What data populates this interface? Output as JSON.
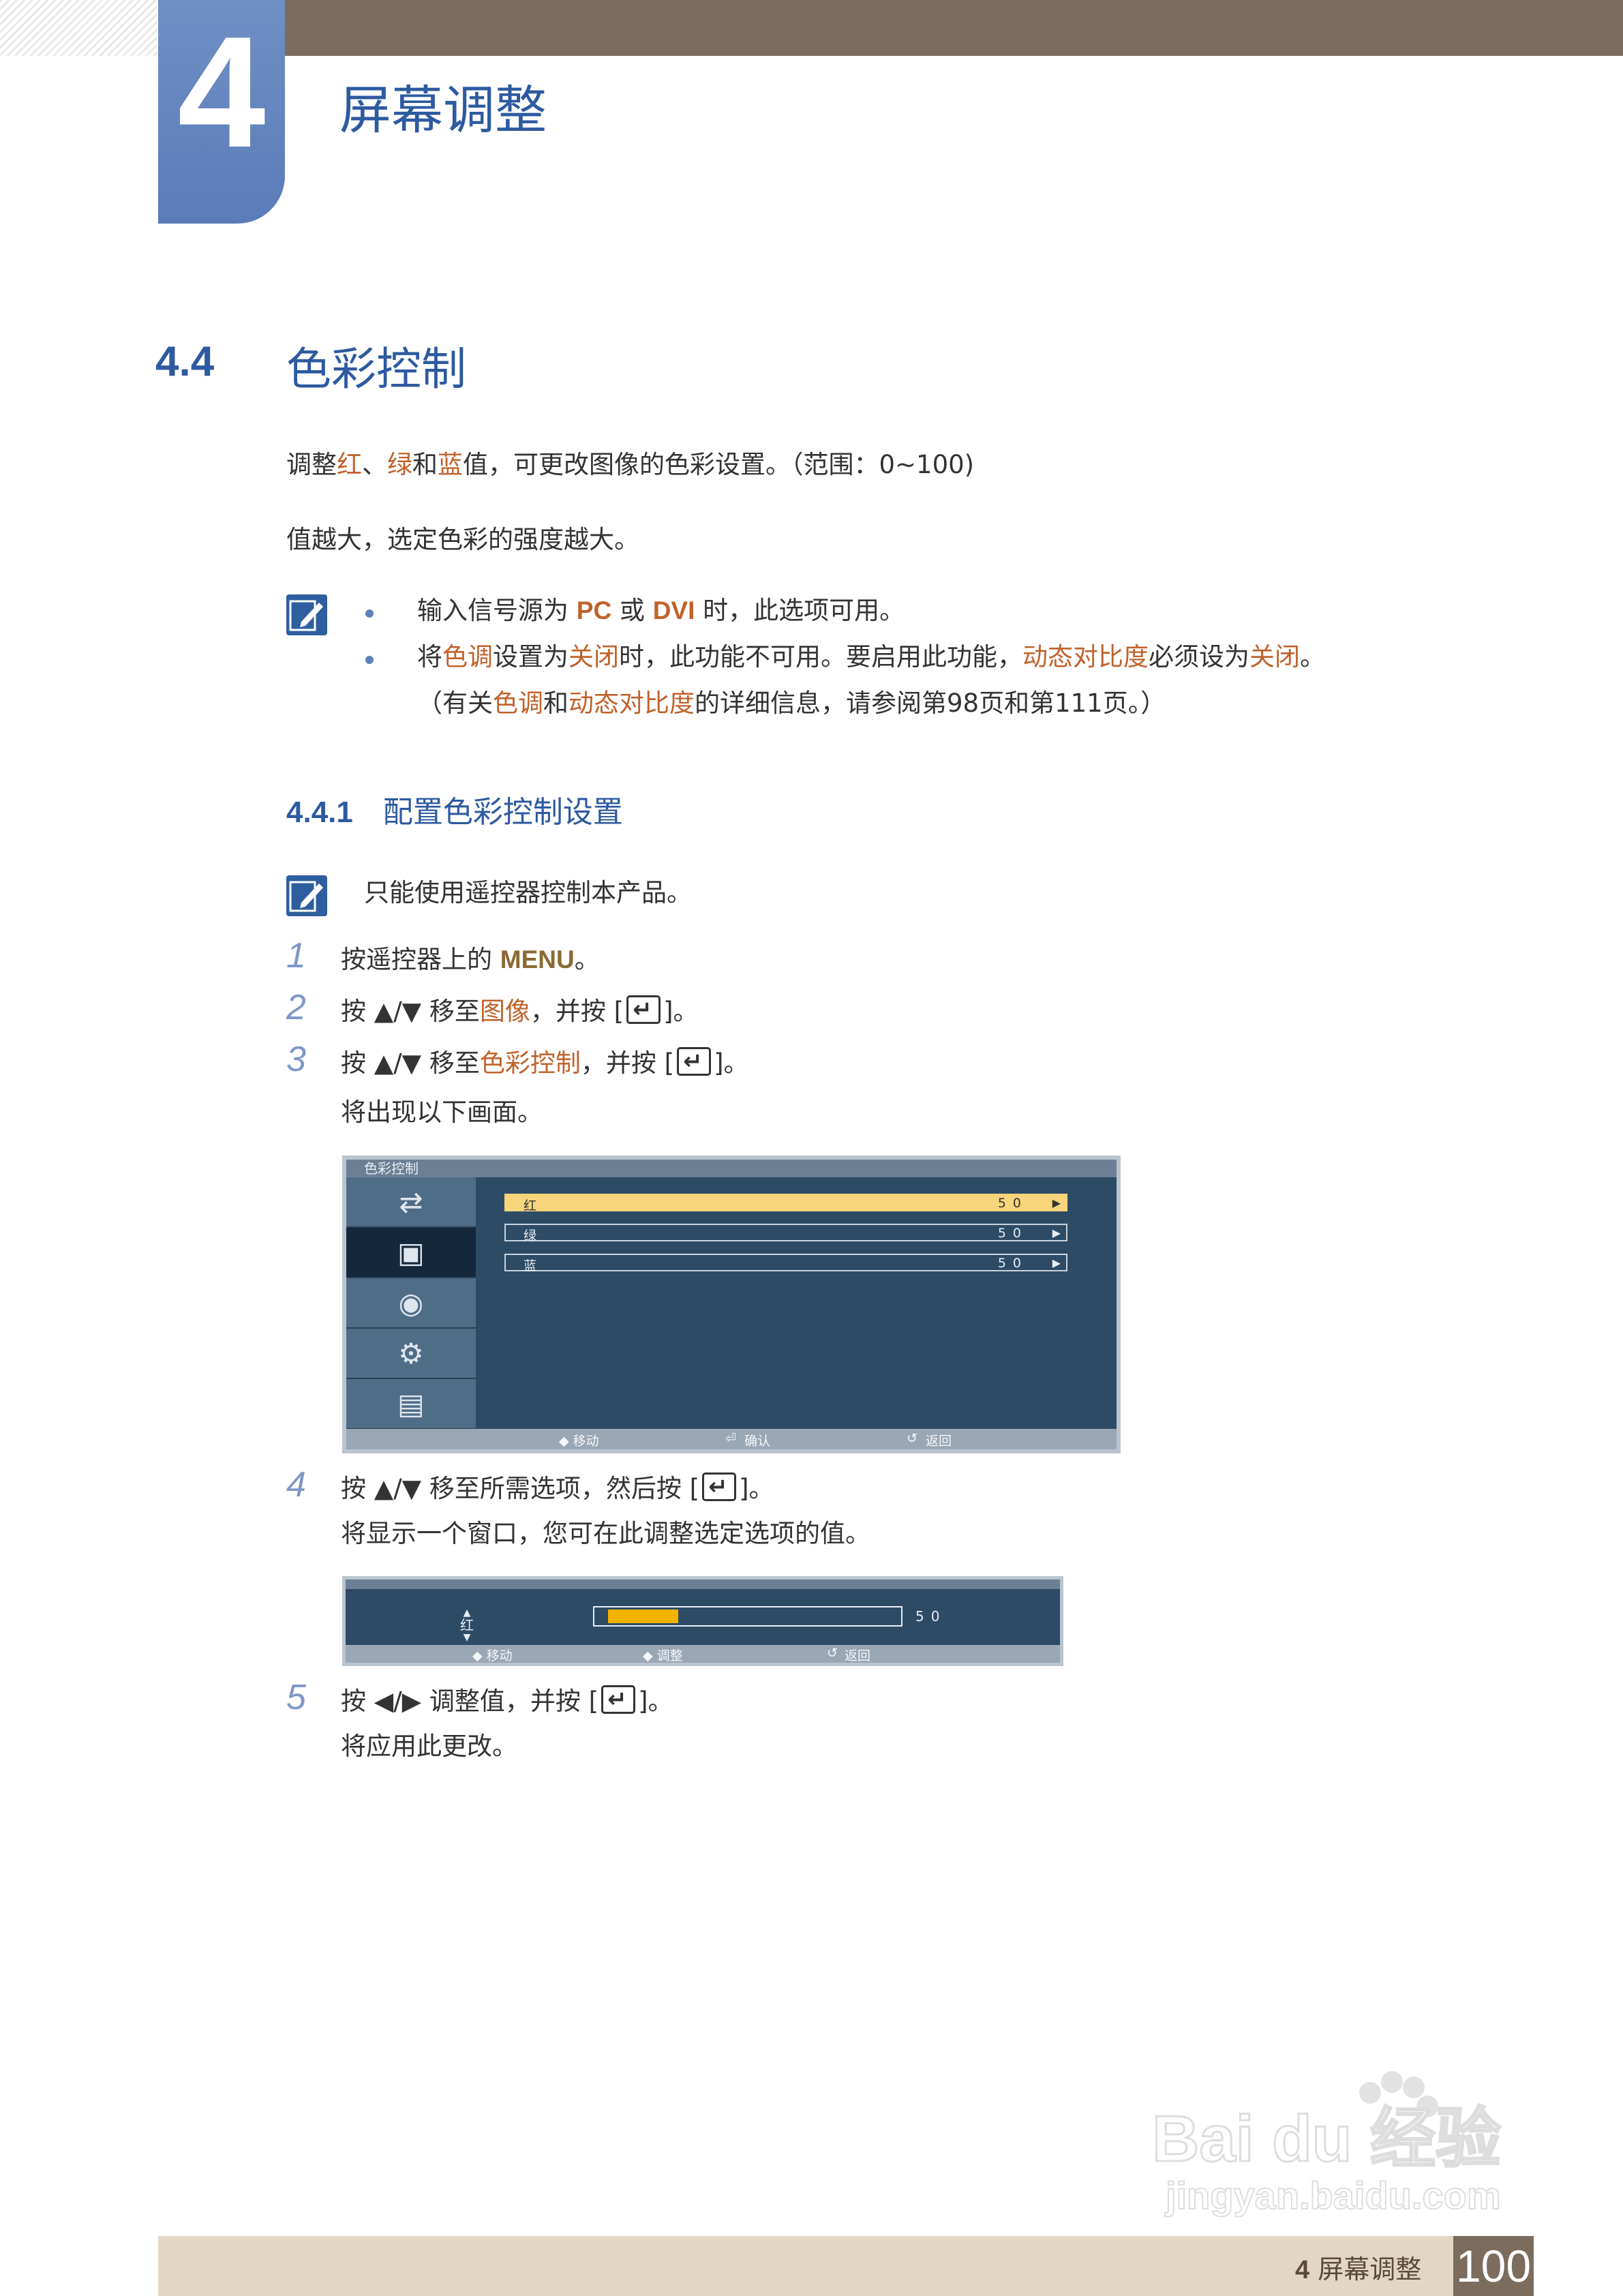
{
  "header": {
    "chapter_number": "4",
    "chapter_title": "屏幕调整"
  },
  "section": {
    "number": "4.4",
    "title": "色彩控制"
  },
  "intro": {
    "line1": {
      "a": "调整",
      "red": "红",
      "sep": "、",
      "green": "绿",
      "and": "和",
      "blue": "蓝",
      "rest": "值，可更改图像的色彩设置。（范围：0~100)"
    },
    "line2": "值越大，选定色彩的强度越大。"
  },
  "notes": {
    "item1": {
      "a": "输入信号源为 ",
      "pc": "PC",
      "or": " 或 ",
      "dvi": "DVI",
      "rest": " 时，此选项可用。"
    },
    "item2": {
      "a": "将",
      "tone": "色调",
      "b": "设置为",
      "off1": "关闭",
      "c": "时，此功能不可用。要启用此功能，",
      "dyn": "动态对比度",
      "d": "必须设为",
      "off2": "关闭",
      "e": "。"
    },
    "item3": {
      "a": "（有关",
      "tone": "色调",
      "b": "和",
      "dyn": "动态对比度",
      "c": "的详细信息，请参阅第98页和第111页。）"
    }
  },
  "subsection": {
    "number": "4.4.1",
    "title": "配置色彩控制设置",
    "note": "只能使用遥控器控制本产品。"
  },
  "steps": [
    {
      "num": "1",
      "a": "按遥控器上的 ",
      "key": "MENU",
      "b": "。"
    },
    {
      "num": "2",
      "a": "按 ▲/▼ 移至",
      "target": "图像",
      "b": "，并按 [",
      "c": "]。"
    },
    {
      "num": "3",
      "a": "按 ▲/▼ 移至",
      "target": "色彩控制",
      "b": "，并按 [",
      "c": "]。",
      "sub": "将出现以下画面。"
    },
    {
      "num": "4",
      "a": "按 ▲/▼ 移至所需选项，然后按 [",
      "c": "]。",
      "sub": "将显示一个窗口，您可在此调整选定选项的值。"
    },
    {
      "num": "5",
      "a": "按 ◀/▶ 调整值，并按 [",
      "c": "]。",
      "sub": "将应用此更改。"
    }
  ],
  "osd1": {
    "title": "色彩控制",
    "rows": [
      {
        "label": "红",
        "value": "50",
        "level": 50
      },
      {
        "label": "绿",
        "value": "50",
        "level": 50
      },
      {
        "label": "蓝",
        "value": "50",
        "level": 50
      }
    ],
    "footer": {
      "move": "◆ 移动",
      "confirm": "确认",
      "back": "返回"
    }
  },
  "osd2": {
    "label": "红",
    "value": "50",
    "level": 50,
    "footer": {
      "move": "◆ 移动",
      "adjust": "◆ 调整",
      "back": "返回"
    }
  },
  "footer": {
    "chapter": "4",
    "title": "屏幕调整",
    "page": "100"
  },
  "watermark": {
    "brand": "Bai du 经验",
    "url": "jingyan.baidu.com"
  },
  "colors": {
    "brand_blue": "#2d5aa0",
    "highlight_orange": "#c0622b",
    "top_bar": "#7b6c5d"
  }
}
